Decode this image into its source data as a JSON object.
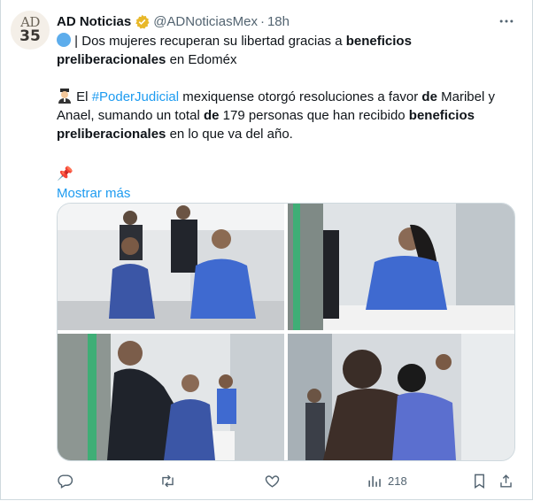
{
  "author": {
    "avatar_line1": "AD",
    "avatar_line2": "35",
    "name": "AD Noticias",
    "handle": "@ADNoticiasMex",
    "separator": "·",
    "time": "18h",
    "verified_color": "#e8b829"
  },
  "tweet": {
    "line1_after_circle": "| Dos mujeres recuperan su libertad gracias a ",
    "line1_bold": "beneficios preliberacionales",
    "line1_end": " en Edoméx",
    "p2_start": " El ",
    "p2_hashtag": "#PoderJudicial",
    "p2_mid1": " mexiquense otorgó resoluciones a favor ",
    "p2_bold_de1": "de",
    "p2_mid2": " Maribel y Anael, sumando un total ",
    "p2_bold_de2": "de",
    "p2_mid3": " 179 personas que han recibido ",
    "p2_bold_end": "beneficios preliberacionales",
    "p2_end": " en lo que va del año.",
    "pin_emoji": "📌",
    "show_more": "Mostrar más"
  },
  "media": {
    "photos": [
      "photo-1",
      "photo-2",
      "photo-3",
      "photo-4"
    ]
  },
  "actions": {
    "views_count": "218"
  },
  "colors": {
    "accent": "#1d9bf0",
    "muted": "#536471",
    "border": "#cfd9de"
  }
}
